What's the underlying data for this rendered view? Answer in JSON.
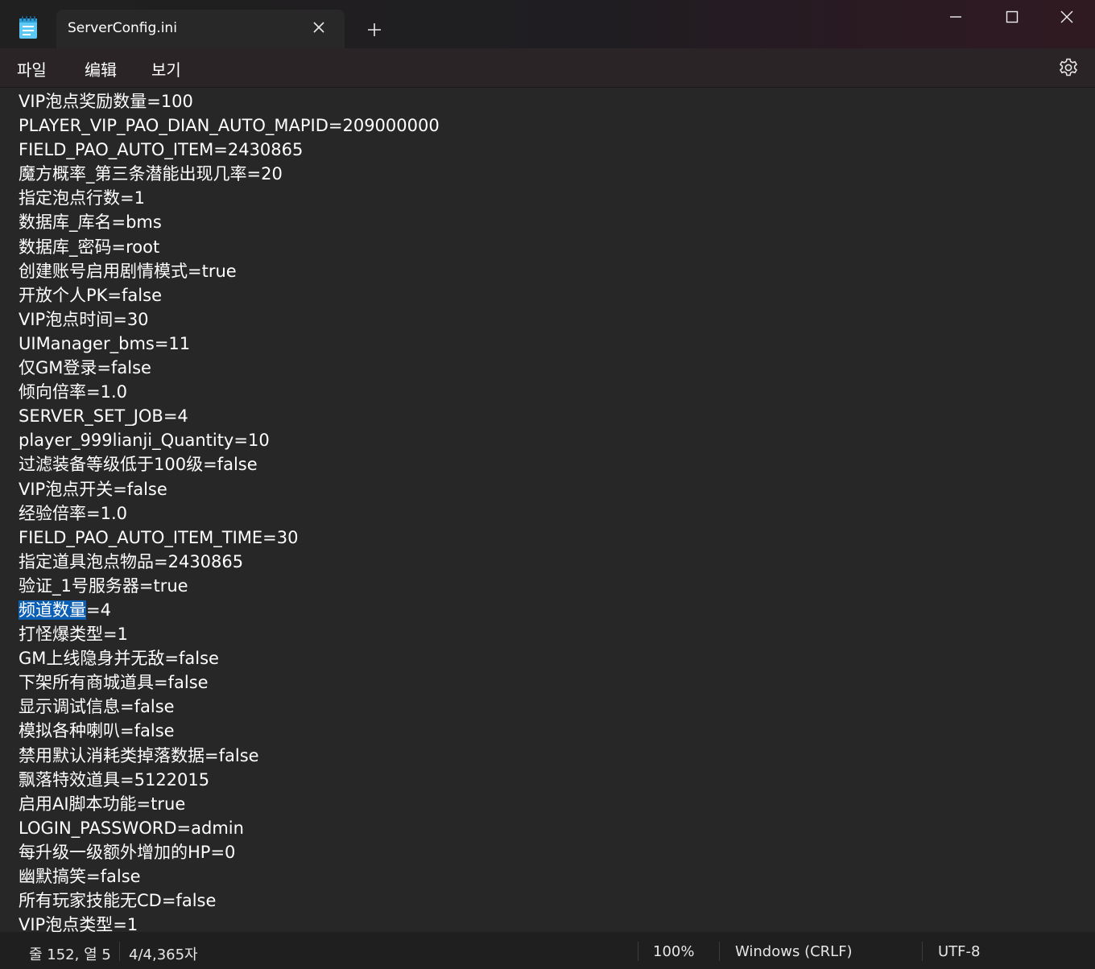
{
  "window": {
    "tab_title": "ServerConfig.ini",
    "icons": {
      "app": "notepad-icon",
      "tab_close": "close-icon",
      "new_tab": "plus-icon",
      "minimize": "minimize-icon",
      "maximize": "maximize-icon",
      "close": "close-icon",
      "settings": "gear-icon"
    }
  },
  "menu": {
    "file": "파일",
    "edit": "编辑",
    "view": "보기"
  },
  "editor": {
    "selection_color": "#0a5fb4",
    "lines": [
      "VIP泡点奖励数量=100",
      "PLAYER_VIP_PAO_DIAN_AUTO_MAPID=209000000",
      "FIELD_PAO_AUTO_ITEM=2430865",
      "魔方概率_第三条潜能出现几率=20",
      "指定泡点行数=1",
      "数据库_库名=bms",
      "数据库_密码=root",
      "创建账号启用剧情模式=true",
      "开放个人PK=false",
      "VIP泡点时间=30",
      "UIManager_bms=11",
      "仅GM登录=false",
      "倾向倍率=1.0",
      "SERVER_SET_JOB=4",
      "player_999lianji_Quantity=10",
      "过滤装备等级低于100级=false",
      "VIP泡点开关=false",
      "经验倍率=1.0",
      "FIELD_PAO_AUTO_ITEM_TIME=30",
      "指定道具泡点物品=2430865",
      "验证_1号服务器=true",
      "",
      "打怪爆类型=1",
      "GM上线隐身并无敌=false",
      "下架所有商城道具=false",
      "显示调试信息=false",
      "模拟各种喇叭=false",
      "禁用默认消耗类掉落数据=false",
      "飘落特效道具=5122015",
      "启用AI脚本功能=true",
      "LOGIN_PASSWORD=admin",
      "每升级一级额外增加的HP=0",
      "幽默搞笑=false",
      "所有玩家技能无CD=false",
      "VIP泡点类型=1"
    ],
    "selected_line": {
      "selected_text": "频道数量",
      "rest_text": "=4"
    }
  },
  "status": {
    "position": "줄 152, 열 5",
    "chars": "4/4,365자",
    "zoom": "100%",
    "line_ending": "Windows (CRLF)",
    "encoding": "UTF-8"
  }
}
